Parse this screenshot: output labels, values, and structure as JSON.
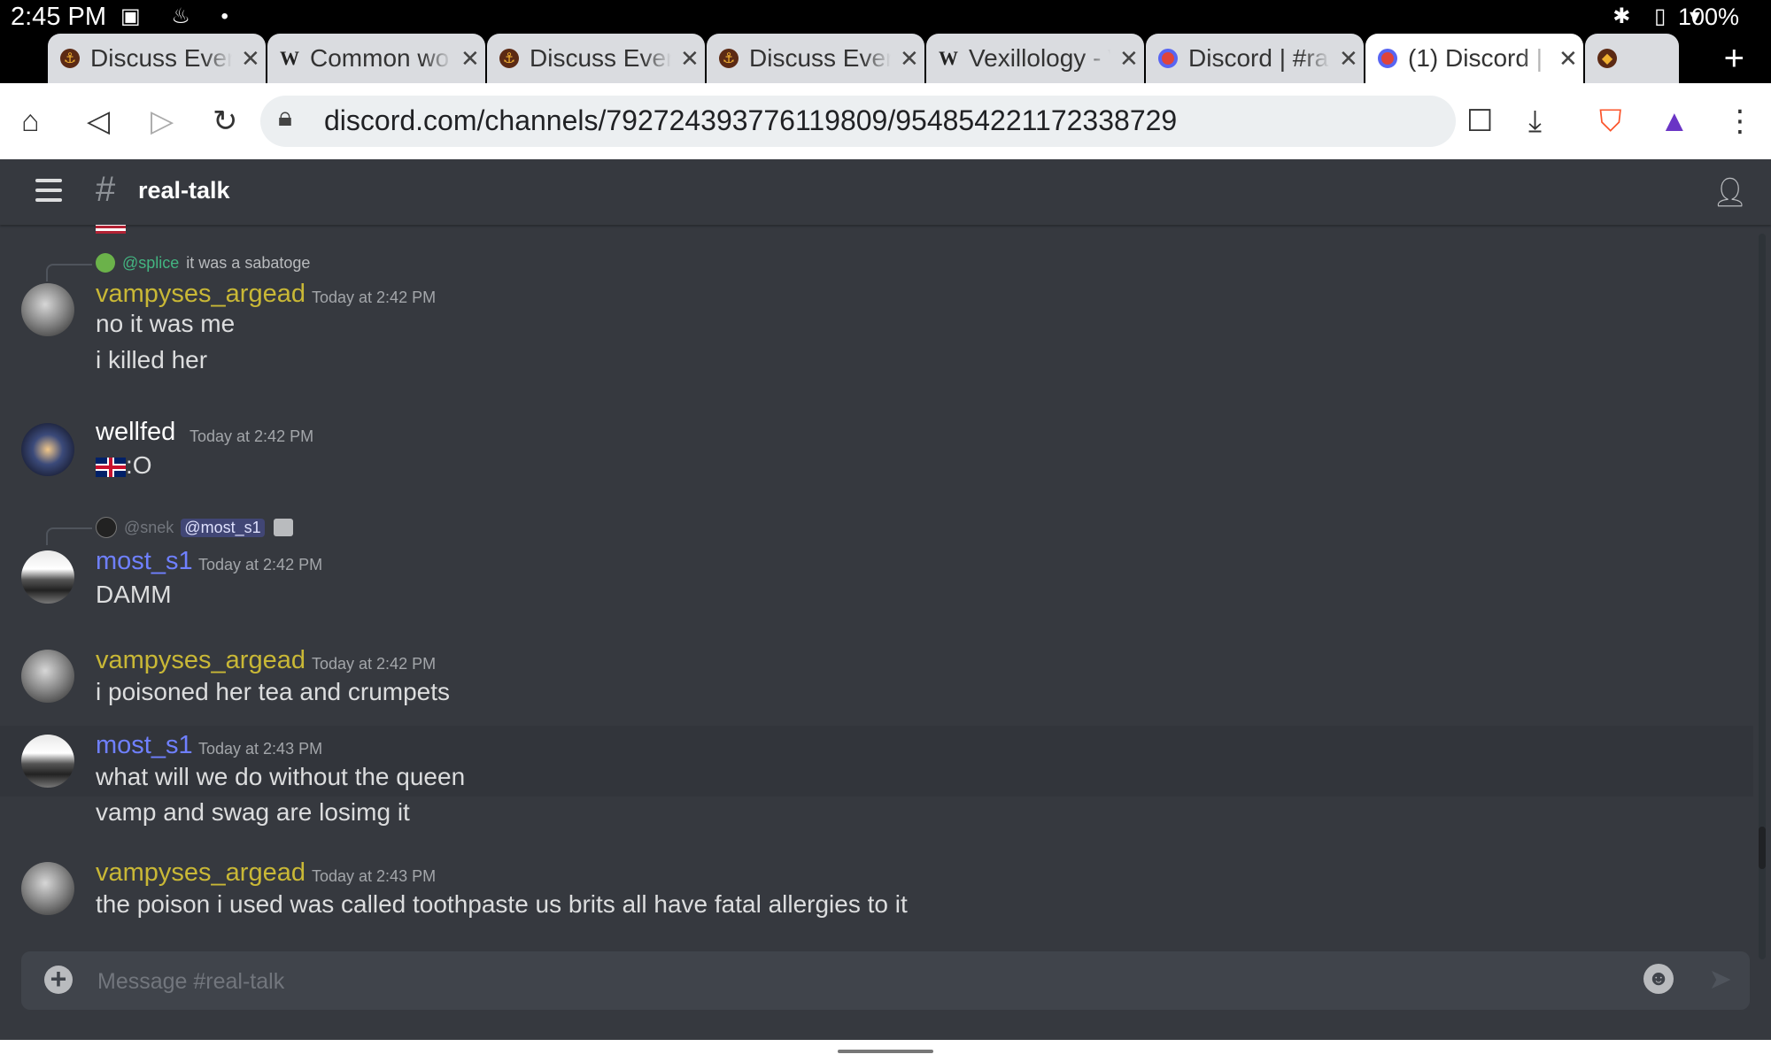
{
  "status_bar": {
    "time": "2:45 PM",
    "left_icons": "▣ ♨ •",
    "right_icons": "✱ ▯ ▾",
    "battery": "100%"
  },
  "tabs": [
    {
      "title": "Discuss Ever",
      "favicon": "ship-icon",
      "active": false
    },
    {
      "title": "Common wo",
      "favicon": "wikipedia-icon",
      "active": false
    },
    {
      "title": "Discuss Ever",
      "favicon": "ship-icon",
      "active": false
    },
    {
      "title": "Discuss Ever",
      "favicon": "ship-icon",
      "active": false
    },
    {
      "title": "Vexillology - V",
      "favicon": "wikipedia-icon",
      "active": false
    },
    {
      "title": "Discord | #ra",
      "favicon": "discord-icon",
      "active": false
    },
    {
      "title": "(1) Discord |",
      "favicon": "discord-icon",
      "active": true
    }
  ],
  "tab_close_glyph": "✕",
  "new_tab_glyph": "+",
  "toolbar": {
    "url": "discord.com/channels/792724393776119809/954854221172338729"
  },
  "channel": {
    "name": "real-talk",
    "hash": "#"
  },
  "messages": [
    {
      "reply_to": {
        "user": "@splice",
        "text": "it was a sabatoge"
      },
      "author": "vampyses_argead",
      "timestamp": "Today at 2:42 PM",
      "lines": [
        "no it was me",
        "i killed her"
      ]
    },
    {
      "author": "wellfed",
      "timestamp": "Today at 2:42 PM",
      "lines": [
        ":O"
      ]
    },
    {
      "reply_to": {
        "user": "@snek",
        "mention": "@most_s1"
      },
      "author": "most_s1",
      "timestamp": "Today at 2:42 PM",
      "lines": [
        "DAMM"
      ]
    },
    {
      "author": "vampyses_argead",
      "timestamp": "Today at 2:42 PM",
      "lines": [
        "i poisoned her tea and crumpets"
      ]
    },
    {
      "author": "most_s1",
      "timestamp": "Today at 2:43 PM",
      "lines": [
        "what will we do without the queen",
        "vamp and swag are losimg it"
      ]
    },
    {
      "author": "vampyses_argead",
      "timestamp": "Today at 2:43 PM",
      "lines": [
        "the poison i used was called toothpaste us brits all have fatal allergies to it"
      ]
    }
  ],
  "composer": {
    "placeholder": "Message #real-talk"
  },
  "colors": {
    "discord_bg": "#36393f",
    "composer_bg": "#40444b",
    "vampyses_name": "#c9b836",
    "most_s1_name": "#6f80ff",
    "wellfed_name": "#ffffff",
    "mention_bg": "#414675"
  }
}
